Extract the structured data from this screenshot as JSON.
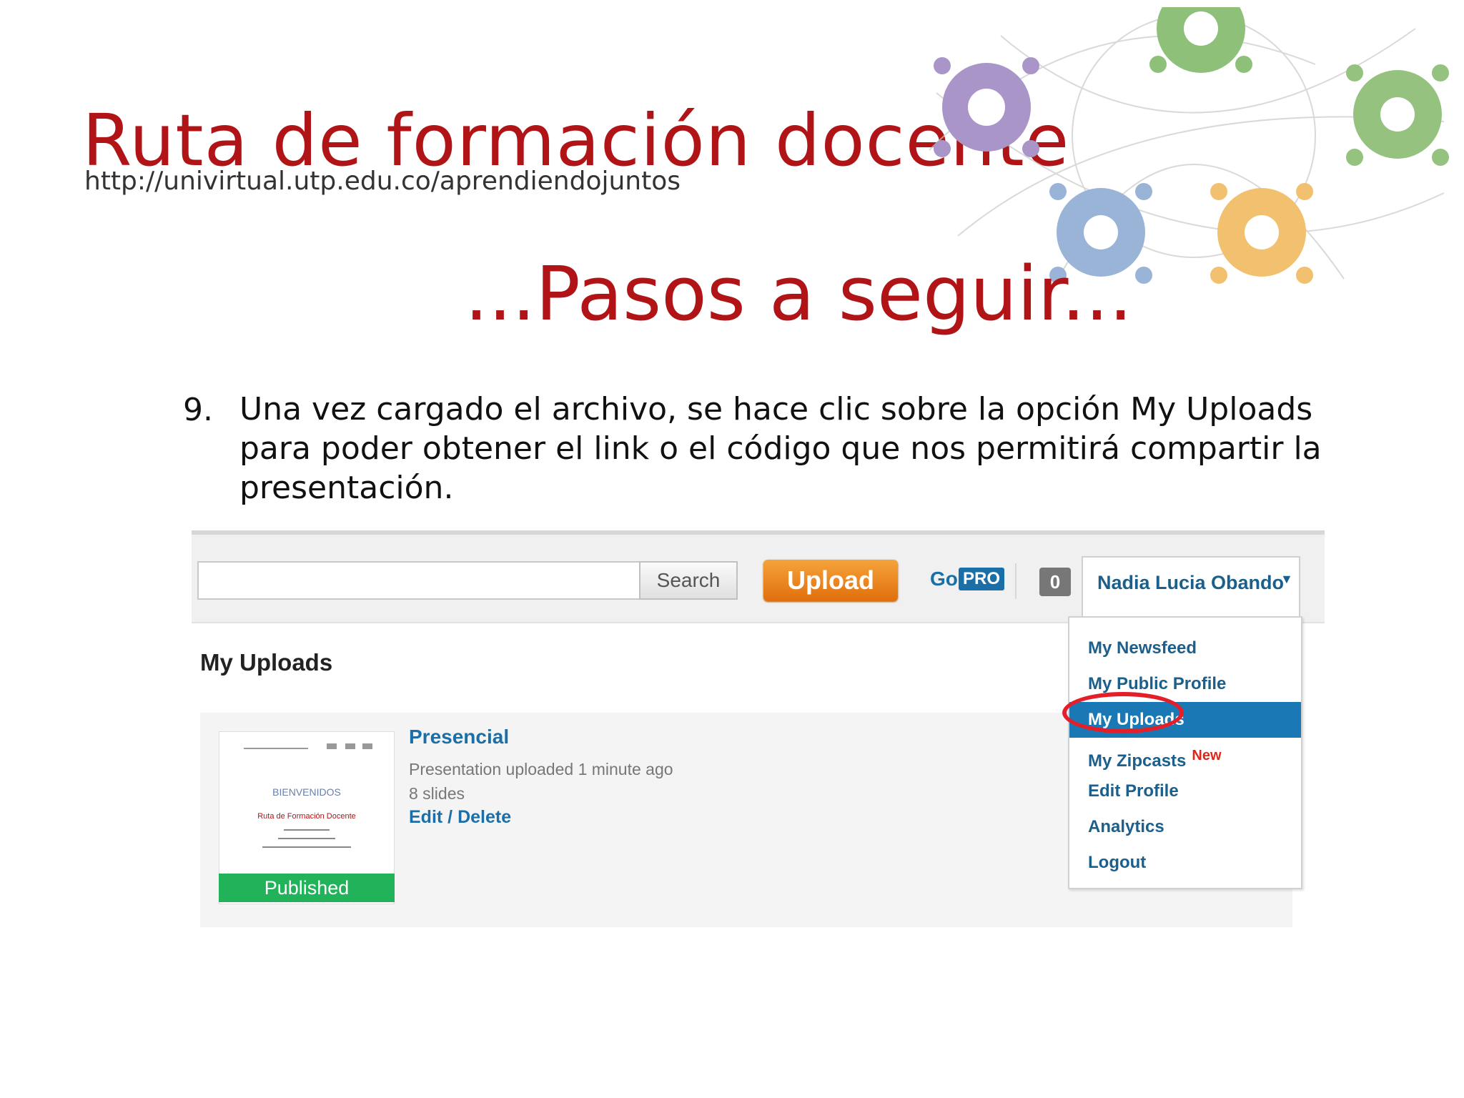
{
  "header": {
    "title": "Ruta de formación docente",
    "url": "http://univirtual.utp.edu.co/aprendiendojuntos"
  },
  "slide": {
    "title": "...Pasos a seguir...",
    "step_number": "9.",
    "step_text": "Una vez cargado el archivo, se hace clic sobre la opción My Uploads para poder obtener el link o el código que nos permitirá compartir la presentación."
  },
  "colors": {
    "brand_red": "#b01417",
    "link_blue": "#1b6fa8",
    "upload_orange": "#e97d1c",
    "published_green": "#22b35a",
    "active_blue": "#1a78b4",
    "highlight_red": "#e3202a"
  },
  "toolbar": {
    "search_placeholder": "",
    "search_label": "Search",
    "upload_label": "Upload",
    "go_label": "Go",
    "pro_label": "PRO",
    "notification_count": "0",
    "user_name": "Nadia Lucia Obando",
    "caret_icon": "caret-down-icon"
  },
  "page": {
    "heading": "My Uploads"
  },
  "upload_item": {
    "title": "Presencial",
    "meta": "Presentation uploaded 1 minute ago",
    "slides": "8 slides",
    "edit_label": "Edit",
    "separator": " / ",
    "delete_label": "Delete",
    "status": "Published",
    "thumbnail": {
      "welcome": "BIENVENIDOS",
      "title": "Ruta de Formación Docente"
    }
  },
  "dropdown": {
    "items": [
      {
        "label": "My Newsfeed"
      },
      {
        "label": "My Public Profile"
      },
      {
        "label": "My Uploads",
        "active": true
      },
      {
        "label": "My Zipcasts",
        "badge": "New"
      },
      {
        "label": "Edit Profile"
      },
      {
        "label": "Analytics"
      },
      {
        "label": "Logout"
      }
    ]
  }
}
